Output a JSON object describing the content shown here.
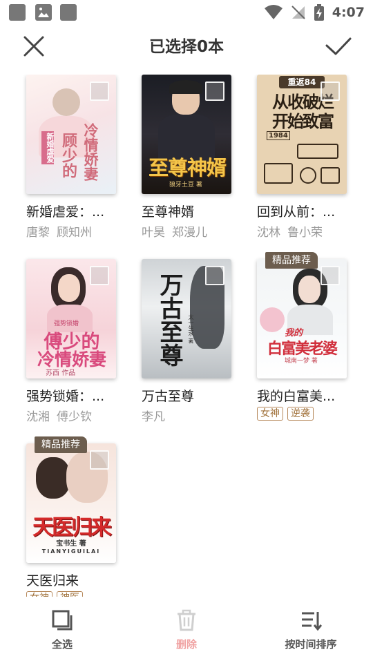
{
  "status_bar": {
    "time": "4:07"
  },
  "header": {
    "title": "已选择0本"
  },
  "books": [
    {
      "title": "新婚虐爱：...",
      "authors": [
        "唐黎",
        "顾知州"
      ],
      "cover": {
        "line1": "冷情娇妻",
        "line2": "顾少的",
        "line3": "新婚虐爱"
      }
    },
    {
      "title": "至尊神婿",
      "authors": [
        "叶昊",
        "郑漫儿"
      ],
      "cover": {
        "line1": "至尊神婿",
        "line2": "狼牙土豆 著"
      }
    },
    {
      "title": "回到从前：...",
      "authors": [
        "沈林",
        "鲁小荣"
      ],
      "cover": {
        "line1": "重返84",
        "line2": "从收破烂",
        "line3": "开始致富",
        "line4": "1984"
      }
    },
    {
      "title": "强势锁婚：...",
      "authors": [
        "沈湘",
        "傅少钦"
      ],
      "cover": {
        "line1": "强势锁婚",
        "line2": "傅少的",
        "line3": "冷情娇妻",
        "line4": "苏西 作品"
      }
    },
    {
      "title": "万古至尊",
      "authors": [
        "李凡"
      ],
      "cover": {
        "line1": "万古至尊",
        "line2": "太一生水 著"
      }
    },
    {
      "title": "我的白富美...",
      "badge": "精品推荐",
      "tags": [
        "女神",
        "逆袭"
      ],
      "cover": {
        "line1": "我的",
        "line2": "白富美老婆",
        "line3": "城南一梦 著"
      }
    },
    {
      "title": "天医归来",
      "badge": "精品推荐",
      "tags": [
        "女神",
        "神医"
      ],
      "cover": {
        "line1": "天医归来",
        "line2": "宝书生 著",
        "line3": "TIANYIGUILAI"
      }
    }
  ],
  "bottom_bar": {
    "select_all": "全选",
    "delete": "删除",
    "sort": "按时间排序"
  },
  "colors": {
    "badge": "#6c5d4e",
    "tag": "#a0713a",
    "delete_disabled": "#f0a3a3"
  }
}
